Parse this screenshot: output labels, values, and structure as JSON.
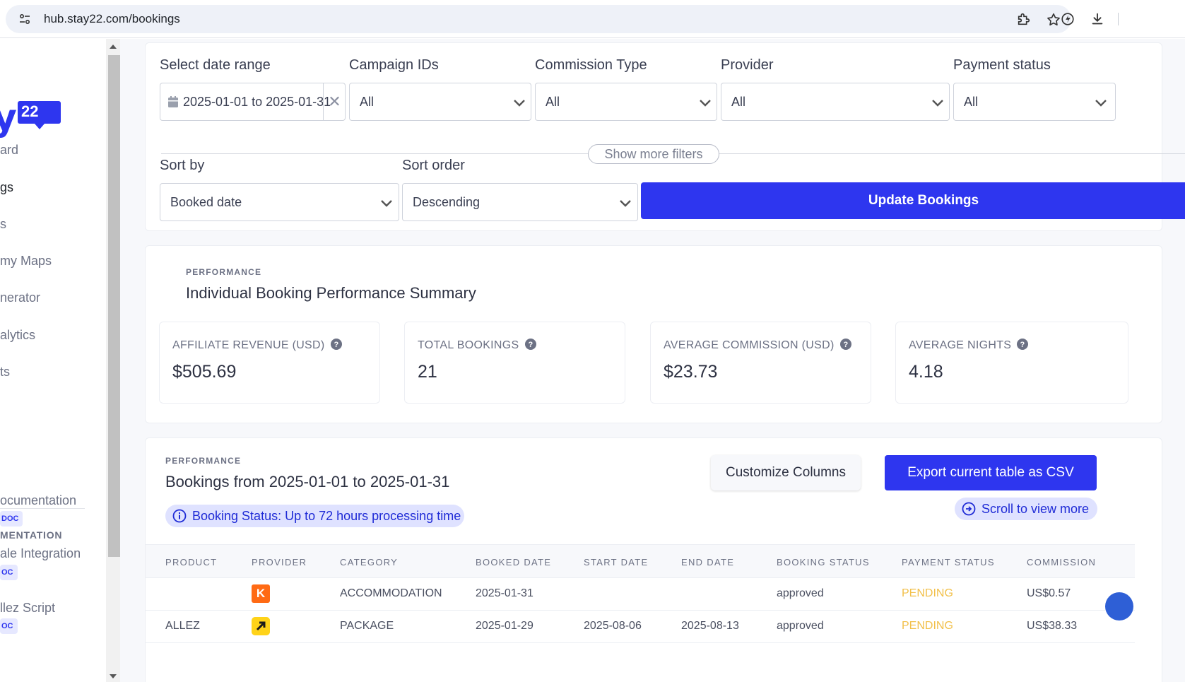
{
  "browser": {
    "url": "hub.stay22.com/bookings"
  },
  "logo": {
    "letter": "y",
    "badge": "22"
  },
  "sidebar": {
    "items": [
      {
        "label": "ard"
      },
      {
        "label": "gs"
      },
      {
        "label": "s"
      },
      {
        "label": " my Maps"
      },
      {
        "label": "nerator"
      },
      {
        "label": "alytics"
      },
      {
        "label": "ts"
      }
    ],
    "doc_heading": "MENTATION",
    "docs": [
      {
        "label": "ocumentation",
        "badge": "DOC"
      },
      {
        "label": "ale Integration",
        "badge": "OC"
      },
      {
        "label": "llez Script",
        "badge": "OC"
      }
    ]
  },
  "filters": {
    "date_label": "Select date range",
    "date_value": "2025-01-01 to 2025-01-31",
    "clear_symbol": "✕",
    "campaign_label": "Campaign IDs",
    "campaign_value": "All",
    "commission_label": "Commission Type",
    "commission_value": "All",
    "provider_label": "Provider",
    "provider_value": "All",
    "payment_label": "Payment status",
    "payment_value": "All",
    "show_more": "Show more filters",
    "sort_by_label": "Sort by",
    "sort_by_value": "Booked date",
    "sort_order_label": "Sort order",
    "sort_order_value": "Descending",
    "update_button": "Update Bookings"
  },
  "summary": {
    "kicker": "PERFORMANCE",
    "title": "Individual Booking Performance Summary",
    "metrics": [
      {
        "label": "AFFILIATE REVENUE (USD)",
        "value": "$505.69"
      },
      {
        "label": "TOTAL BOOKINGS",
        "value": "21"
      },
      {
        "label": "AVERAGE COMMISSION (USD)",
        "value": "$23.73"
      },
      {
        "label": "AVERAGE NIGHTS",
        "value": "4.18"
      }
    ]
  },
  "bookings": {
    "kicker": "PERFORMANCE",
    "title": "Bookings from 2025-01-01 to 2025-01-31",
    "customize_button": "Customize Columns",
    "export_button": "Export current table as CSV",
    "scroll_hint": "Scroll to view more",
    "status_note": "Booking Status: Up to 72 hours processing time",
    "columns": [
      "PRODUCT",
      "PROVIDER",
      "CATEGORY",
      "BOOKED DATE",
      "START DATE",
      "END DATE",
      "BOOKING STATUS",
      "PAYMENT STATUS",
      "COMMISSION"
    ],
    "rows": [
      {
        "product": "",
        "provider_icon": "kayak-logo",
        "provider_letter": "K",
        "category": "ACCOMMODATION",
        "booked": "2025-01-31",
        "start": "",
        "end": "",
        "booking_status": "approved",
        "payment_status": "PENDING",
        "commission": "US$0.57"
      },
      {
        "product": "ALLEZ",
        "provider_icon": "expedia-logo",
        "category": "PACKAGE",
        "booked": "2025-01-29",
        "start": "2025-08-06",
        "end": "2025-08-13",
        "booking_status": "approved",
        "payment_status": "PENDING",
        "commission": "US$38.33"
      }
    ]
  }
}
